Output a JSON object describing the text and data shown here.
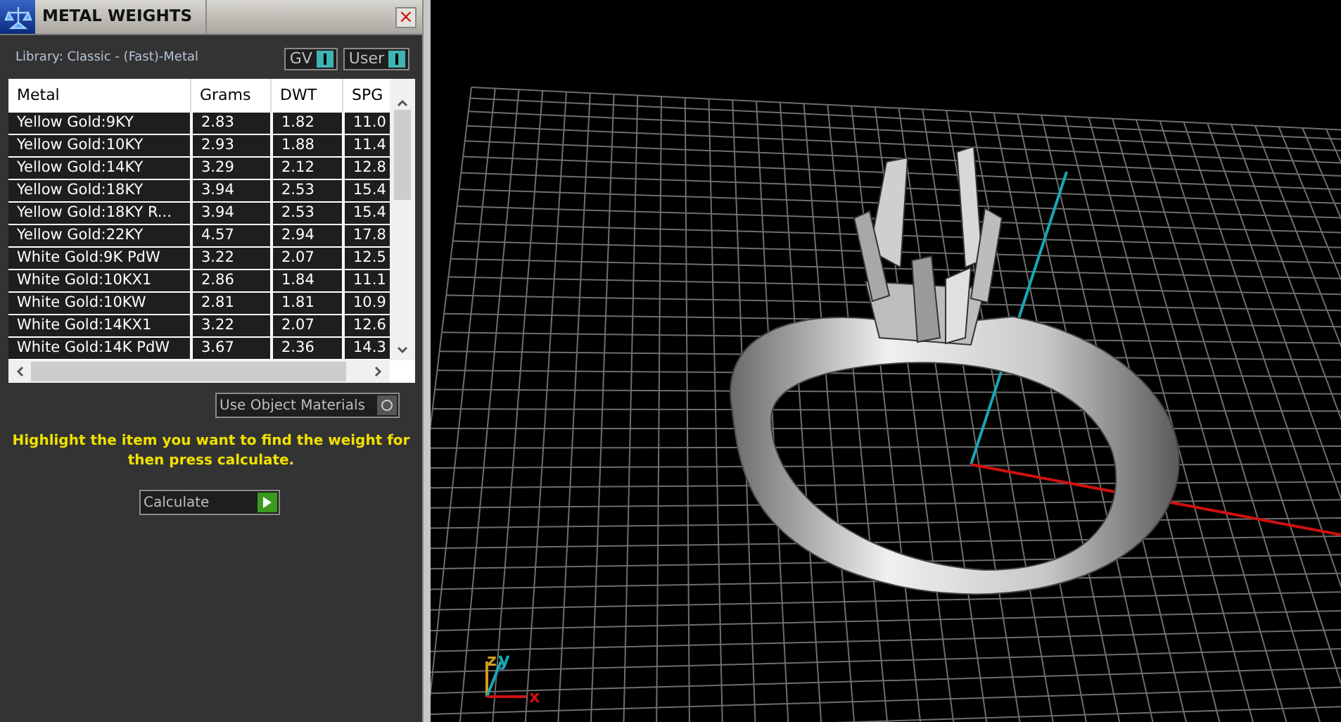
{
  "panel": {
    "title": "METAL WEIGHTS",
    "close": "×",
    "library": "Library: Classic - (Fast)-Metal",
    "toggles": [
      {
        "label": "GV",
        "on": true
      },
      {
        "label": "User",
        "on": true
      }
    ],
    "table": {
      "columns": [
        "Metal",
        "Grams",
        "DWT",
        "SPG"
      ],
      "rows": [
        [
          "Yellow Gold:9KY",
          "2.83",
          "1.82",
          "11.0"
        ],
        [
          "Yellow Gold:10KY",
          "2.93",
          "1.88",
          "11.4"
        ],
        [
          "Yellow Gold:14KY",
          "3.29",
          "2.12",
          "12.8"
        ],
        [
          "Yellow Gold:18KY",
          "3.94",
          "2.53",
          "15.4"
        ],
        [
          "Yellow Gold:18KY R...",
          "3.94",
          "2.53",
          "15.4"
        ],
        [
          "Yellow Gold:22KY",
          "4.57",
          "2.94",
          "17.8"
        ],
        [
          "White Gold:9K PdW",
          "3.22",
          "2.07",
          "12.5"
        ],
        [
          "White Gold:10KX1",
          "2.86",
          "1.84",
          "11.1"
        ],
        [
          "White Gold:10KW",
          "2.81",
          "1.81",
          "10.9"
        ],
        [
          "White Gold:14KX1",
          "3.22",
          "2.07",
          "12.6"
        ],
        [
          "White Gold:14K PdW",
          "3.67",
          "2.36",
          "14.3"
        ]
      ]
    },
    "use_object_materials": {
      "label": "Use Object Materials",
      "checked": false
    },
    "hint": "Highlight the item you want to find the weight for then press calculate.",
    "calculate": "Calculate"
  },
  "viewport": {
    "axes": {
      "z": "z",
      "y": "y",
      "x": "x"
    }
  }
}
